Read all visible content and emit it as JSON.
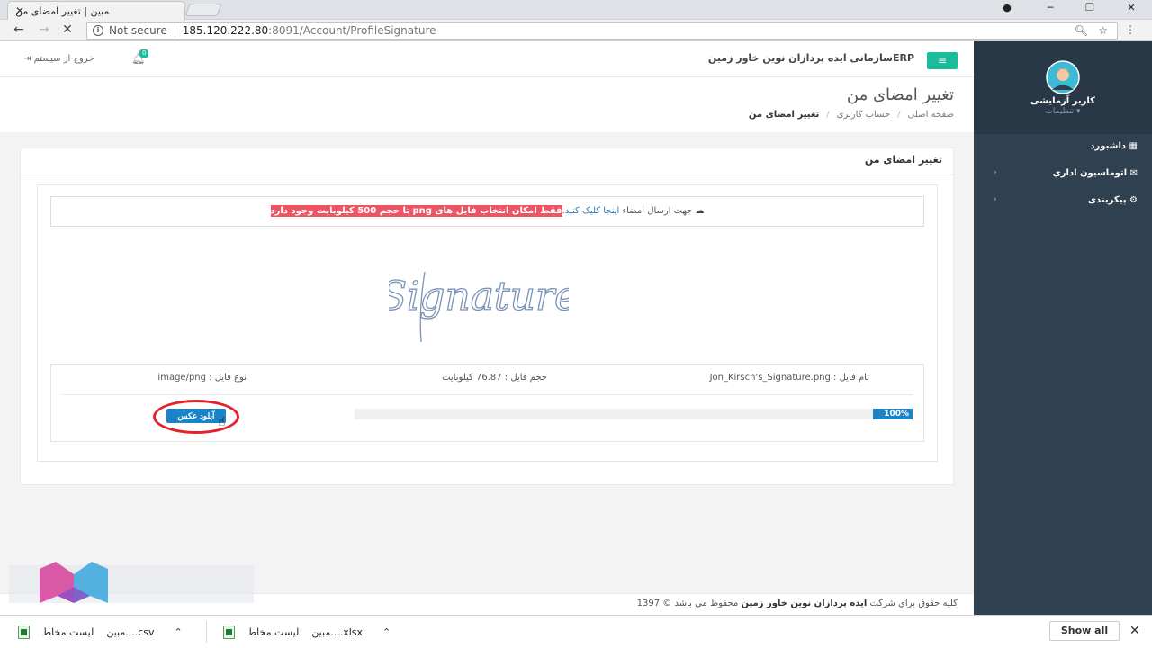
{
  "browser": {
    "tab_title": "مبین | تغییر امضای من",
    "tab_close": "✕",
    "notsecure": "Not secure",
    "url_host": "185.120.222.80",
    "url_rest": ":8091/Account/ProfileSignature"
  },
  "header": {
    "logout_label": "خروج از سیستم",
    "notification_count": "0",
    "brand": "ERPسازمانی ایده پردازان نوین خاور زمین"
  },
  "page": {
    "title": "تغییر امضای من",
    "breadcrumb": [
      "صفحه اصلی",
      "حساب کاربری",
      "تغییر امضای من"
    ]
  },
  "panel": {
    "title": "تغییر امضای من",
    "notice_text": "جهت ارسال امضاء",
    "notice_link": "اینجا کلیک کنید.",
    "notice_warning": "فقط امکان انتخاب فایل های png تا حجم 500 کیلوبایت وجود دارد",
    "signature_text": "Signature",
    "file_name_label": "نام فایل : Jon_Kirsch's_Signature.png",
    "file_size_label": "حجم فایل : 76.87 کیلوبایت",
    "file_type_label": "نوع فایل : image/png",
    "progress_label": "100%",
    "progress_fraction": 1.0,
    "upload_button": "آپلود عکس"
  },
  "footer": {
    "prefix": "کلیه حقوق براي شرکت",
    "company": "ایده پردازان نوین خاور زمین",
    "suffix": "محفوظ مي باشد © 1397"
  },
  "sidebar": {
    "user_name": "کاربر آزمایشی",
    "settings_label": "▾ تنظیمات",
    "items": [
      {
        "label": "داشبورد",
        "icon": "th-large-icon"
      },
      {
        "label": "اتوماسیون اداري",
        "icon": "envelope-icon"
      },
      {
        "label": "پیکربندی",
        "icon": "cogs-icon"
      }
    ]
  },
  "downloads": {
    "item1_name": "مبین....csv",
    "item1_prefix": "لیست مخاط",
    "item2_name": "مبین....xlsx",
    "item2_prefix": "لیست مخاط",
    "show_all": "Show all"
  },
  "colors": {
    "accent": "#1abc9c",
    "sidebar": "#2f4050",
    "primary_button": "#1c84c6",
    "warning": "#ed5565"
  }
}
